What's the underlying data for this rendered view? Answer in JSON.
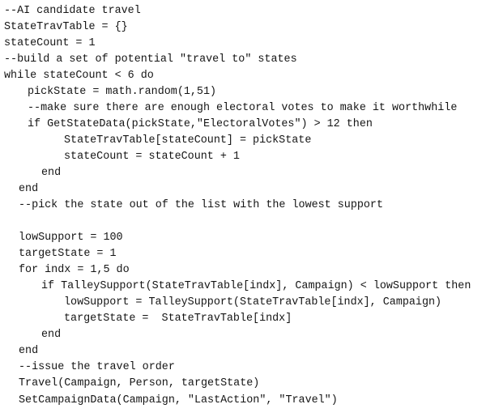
{
  "code": {
    "lines": [
      "--AI candidate travel",
      "StateTravTable = {}",
      "stateCount = 1",
      "--build a set of potential \"travel to\" states",
      "while stateCount < 6 do",
      "pickState = math.random(1,51)",
      "--make sure there are enough electoral votes to make it worthwhile",
      "if GetStateData(pickState,\"ElectoralVotes\") > 12 then",
      "StateTravTable[stateCount] = pickState",
      "stateCount = stateCount + 1",
      "end",
      "end",
      "--pick the state out of the list with the lowest support",
      "",
      "lowSupport = 100",
      "targetState = 1",
      "for indx = 1,5 do",
      "if TalleySupport(StateTravTable[indx], Campaign) < lowSupport then",
      "lowSupport = TalleySupport(StateTravTable[indx], Campaign)",
      "targetState =  StateTravTable[indx]",
      "end",
      "end",
      "--issue the travel order",
      "Travel(Campaign, Person, targetState)",
      "SetCampaignData(Campaign, \"LastAction\", \"Travel\")"
    ]
  }
}
